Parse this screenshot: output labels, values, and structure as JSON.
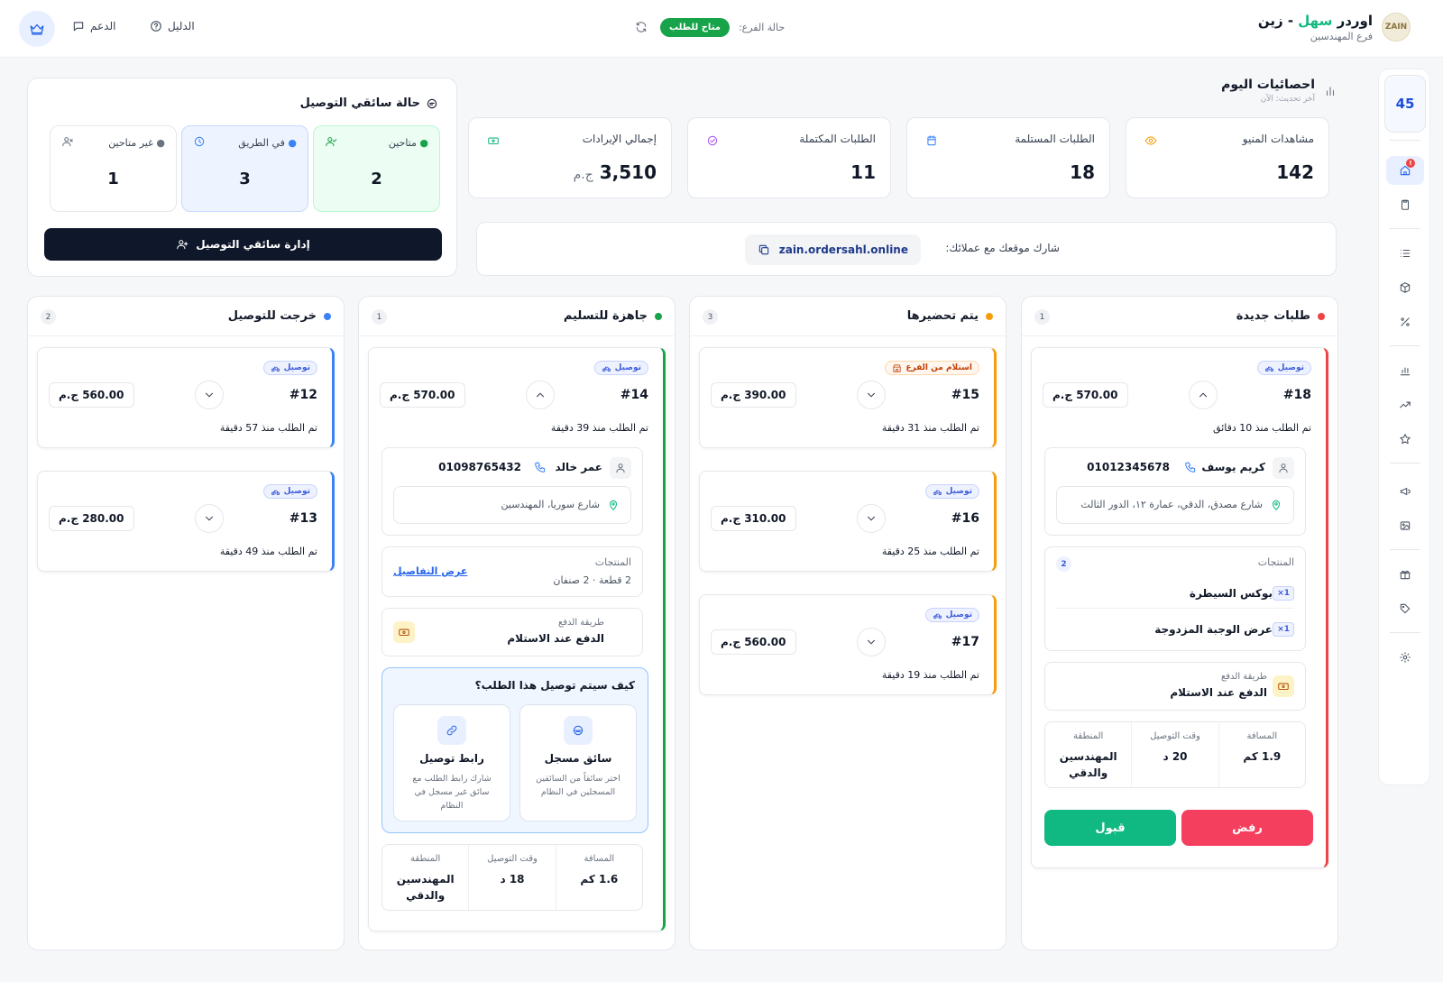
{
  "header": {
    "brand_name": "اوردر",
    "brand_accent": "سهل",
    "brand_suffix": "- زين",
    "branch_name": "فرع المهندسين",
    "logo_text": "ZAIN",
    "branch_status_label": "حالة الفرع:",
    "branch_status": "متاح للطلب",
    "guide": "الدليل",
    "support": "الدعم"
  },
  "sidebar": {
    "counter": "45",
    "notif": "!"
  },
  "stats": {
    "title": "احصائيات اليوم",
    "updated": "آخر تحديث: الآن",
    "cards": [
      {
        "label": "مشاهدات المنيو",
        "value": "142"
      },
      {
        "label": "الطلبات المستلمة",
        "value": "18"
      },
      {
        "label": "الطلبات المكتملة",
        "value": "11"
      },
      {
        "label": "إجمالي الإيرادات",
        "value": "3,510",
        "currency": "ج.م"
      }
    ],
    "share_label": "شارك موقعك مع عملائك:",
    "share_url": "zain.ordersahl.online"
  },
  "drivers": {
    "title": "حالة سائقي التوصيل",
    "available": {
      "label": "متاحين",
      "value": "2"
    },
    "on_way": {
      "label": "في الطريق",
      "value": "3"
    },
    "unavailable": {
      "label": "غير متاحين",
      "value": "1"
    },
    "manage": "إدارة سائقي التوصيل"
  },
  "columns": {
    "new": {
      "title": "طلبات جديدة",
      "count": "1",
      "orders": [
        {
          "tag": "توصيل",
          "id": "#18",
          "price": "570.00 ج.م",
          "time": "تم الطلب منذ 10 دقائق",
          "customer": "كريم يوسف",
          "phone": "01012345678",
          "address": "شارع مصدق، الدقي، عمارة ١٢، الدور الثالث",
          "products_label": "المنتجات",
          "products_count": "2",
          "products": [
            {
              "qty": "×1",
              "name": "بوكس السيطرة"
            },
            {
              "qty": "×1",
              "name": "عرض الوجبة المزدوجة"
            }
          ],
          "payment_label": "طريقة الدفع",
          "payment": "الدفع عند الاستلام",
          "distance_label": "المسافة",
          "distance": "1.9 كم",
          "eta_label": "وقت التوصيل",
          "eta": "20 د",
          "area_label": "المنطقة",
          "area": "المهندسين والدقي",
          "reject": "رفض",
          "accept": "قبول"
        }
      ]
    },
    "preparing": {
      "title": "يتم تحضيرها",
      "count": "3",
      "orders": [
        {
          "tag": "استلام من الفرع",
          "id": "#15",
          "price": "390.00 ج.م",
          "time": "تم الطلب منذ 31 دقيقة"
        },
        {
          "tag": "توصيل",
          "id": "#16",
          "price": "310.00 ج.م",
          "time": "تم الطلب منذ 25 دقيقة"
        },
        {
          "tag": "توصيل",
          "id": "#17",
          "price": "560.00 ج.م",
          "time": "تم الطلب منذ 19 دقيقة"
        }
      ]
    },
    "ready": {
      "title": "جاهزة للتسليم",
      "count": "1",
      "orders": [
        {
          "tag": "توصيل",
          "id": "#14",
          "price": "570.00 ج.م",
          "time": "تم الطلب منذ 39 دقيقة",
          "customer": "عمر خالد",
          "phone": "01098765432",
          "address": "شارع سوريا، المهندسين",
          "products_label": "المنتجات",
          "products_summary": "2 قطعة · 2 صنفان",
          "details": "عرض التفاصيل",
          "payment_label": "طريقة الدفع",
          "payment": "الدفع عند الاستلام",
          "how_title": "كيف سيتم توصيل هذا الطلب؟",
          "opt_registered": {
            "title": "سائق مسجل",
            "desc": "اختر سائقاً من السائقين المسجلين في النظام"
          },
          "opt_link": {
            "title": "رابط توصيل",
            "desc": "شارك رابط الطلب مع سائق غير مسجل في النظام"
          },
          "distance_label": "المسافة",
          "distance": "1.6 كم",
          "eta_label": "وقت التوصيل",
          "eta": "18 د",
          "area_label": "المنطقة",
          "area": "المهندسين والدقي"
        }
      ]
    },
    "out": {
      "title": "خرجت للتوصيل",
      "count": "2",
      "orders": [
        {
          "tag": "توصيل",
          "id": "#12",
          "price": "560.00 ج.م",
          "time": "تم الطلب منذ 57 دقيقة"
        },
        {
          "tag": "توصيل",
          "id": "#13",
          "price": "280.00 ج.م",
          "time": "تم الطلب منذ 49 دقيقة"
        }
      ]
    }
  },
  "colors": {
    "new": "#ef4444",
    "preparing": "#f59e0b",
    "ready": "#16a34a",
    "out": "#3b82f6",
    "primary": "#2563eb",
    "success": "#10b981",
    "danger": "#f43f5e"
  }
}
